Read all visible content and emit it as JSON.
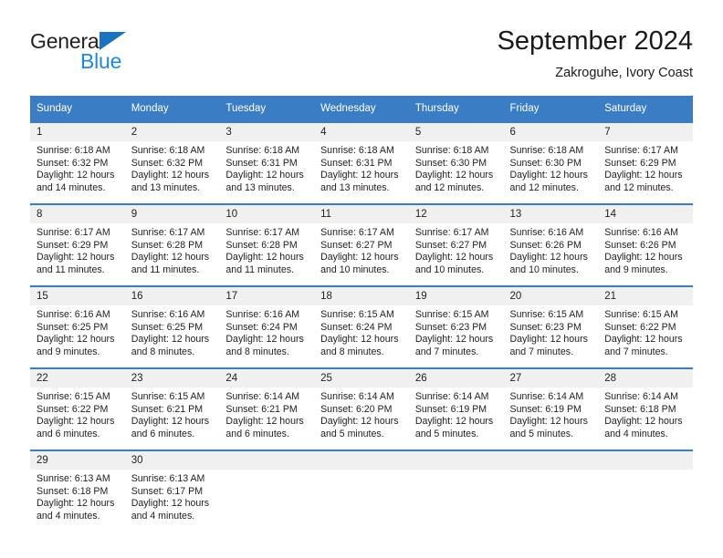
{
  "brand": {
    "name_part1": "General",
    "name_part2": "Blue",
    "triangle_icon": "brand-triangle-icon",
    "color_dark": "#231f20",
    "color_blue": "#2387d8"
  },
  "header": {
    "title": "September 2024",
    "subtitle": "Zakroguhe, Ivory Coast"
  },
  "theme": {
    "header_bg": "#3a7dc4",
    "daynum_bg": "#f0f0f0",
    "text": "#222222"
  },
  "weekday_headers": [
    "Sunday",
    "Monday",
    "Tuesday",
    "Wednesday",
    "Thursday",
    "Friday",
    "Saturday"
  ],
  "weeks": [
    {
      "days": [
        {
          "date": "1",
          "sunrise": "Sunrise: 6:18 AM",
          "sunset": "Sunset: 6:32 PM",
          "daylight_line1": "Daylight: 12 hours",
          "daylight_line2": "and 14 minutes."
        },
        {
          "date": "2",
          "sunrise": "Sunrise: 6:18 AM",
          "sunset": "Sunset: 6:32 PM",
          "daylight_line1": "Daylight: 12 hours",
          "daylight_line2": "and 13 minutes."
        },
        {
          "date": "3",
          "sunrise": "Sunrise: 6:18 AM",
          "sunset": "Sunset: 6:31 PM",
          "daylight_line1": "Daylight: 12 hours",
          "daylight_line2": "and 13 minutes."
        },
        {
          "date": "4",
          "sunrise": "Sunrise: 6:18 AM",
          "sunset": "Sunset: 6:31 PM",
          "daylight_line1": "Daylight: 12 hours",
          "daylight_line2": "and 13 minutes."
        },
        {
          "date": "5",
          "sunrise": "Sunrise: 6:18 AM",
          "sunset": "Sunset: 6:30 PM",
          "daylight_line1": "Daylight: 12 hours",
          "daylight_line2": "and 12 minutes."
        },
        {
          "date": "6",
          "sunrise": "Sunrise: 6:18 AM",
          "sunset": "Sunset: 6:30 PM",
          "daylight_line1": "Daylight: 12 hours",
          "daylight_line2": "and 12 minutes."
        },
        {
          "date": "7",
          "sunrise": "Sunrise: 6:17 AM",
          "sunset": "Sunset: 6:29 PM",
          "daylight_line1": "Daylight: 12 hours",
          "daylight_line2": "and 12 minutes."
        }
      ]
    },
    {
      "days": [
        {
          "date": "8",
          "sunrise": "Sunrise: 6:17 AM",
          "sunset": "Sunset: 6:29 PM",
          "daylight_line1": "Daylight: 12 hours",
          "daylight_line2": "and 11 minutes."
        },
        {
          "date": "9",
          "sunrise": "Sunrise: 6:17 AM",
          "sunset": "Sunset: 6:28 PM",
          "daylight_line1": "Daylight: 12 hours",
          "daylight_line2": "and 11 minutes."
        },
        {
          "date": "10",
          "sunrise": "Sunrise: 6:17 AM",
          "sunset": "Sunset: 6:28 PM",
          "daylight_line1": "Daylight: 12 hours",
          "daylight_line2": "and 11 minutes."
        },
        {
          "date": "11",
          "sunrise": "Sunrise: 6:17 AM",
          "sunset": "Sunset: 6:27 PM",
          "daylight_line1": "Daylight: 12 hours",
          "daylight_line2": "and 10 minutes."
        },
        {
          "date": "12",
          "sunrise": "Sunrise: 6:17 AM",
          "sunset": "Sunset: 6:27 PM",
          "daylight_line1": "Daylight: 12 hours",
          "daylight_line2": "and 10 minutes."
        },
        {
          "date": "13",
          "sunrise": "Sunrise: 6:16 AM",
          "sunset": "Sunset: 6:26 PM",
          "daylight_line1": "Daylight: 12 hours",
          "daylight_line2": "and 10 minutes."
        },
        {
          "date": "14",
          "sunrise": "Sunrise: 6:16 AM",
          "sunset": "Sunset: 6:26 PM",
          "daylight_line1": "Daylight: 12 hours",
          "daylight_line2": "and 9 minutes."
        }
      ]
    },
    {
      "days": [
        {
          "date": "15",
          "sunrise": "Sunrise: 6:16 AM",
          "sunset": "Sunset: 6:25 PM",
          "daylight_line1": "Daylight: 12 hours",
          "daylight_line2": "and 9 minutes."
        },
        {
          "date": "16",
          "sunrise": "Sunrise: 6:16 AM",
          "sunset": "Sunset: 6:25 PM",
          "daylight_line1": "Daylight: 12 hours",
          "daylight_line2": "and 8 minutes."
        },
        {
          "date": "17",
          "sunrise": "Sunrise: 6:16 AM",
          "sunset": "Sunset: 6:24 PM",
          "daylight_line1": "Daylight: 12 hours",
          "daylight_line2": "and 8 minutes."
        },
        {
          "date": "18",
          "sunrise": "Sunrise: 6:15 AM",
          "sunset": "Sunset: 6:24 PM",
          "daylight_line1": "Daylight: 12 hours",
          "daylight_line2": "and 8 minutes."
        },
        {
          "date": "19",
          "sunrise": "Sunrise: 6:15 AM",
          "sunset": "Sunset: 6:23 PM",
          "daylight_line1": "Daylight: 12 hours",
          "daylight_line2": "and 7 minutes."
        },
        {
          "date": "20",
          "sunrise": "Sunrise: 6:15 AM",
          "sunset": "Sunset: 6:23 PM",
          "daylight_line1": "Daylight: 12 hours",
          "daylight_line2": "and 7 minutes."
        },
        {
          "date": "21",
          "sunrise": "Sunrise: 6:15 AM",
          "sunset": "Sunset: 6:22 PM",
          "daylight_line1": "Daylight: 12 hours",
          "daylight_line2": "and 7 minutes."
        }
      ]
    },
    {
      "days": [
        {
          "date": "22",
          "sunrise": "Sunrise: 6:15 AM",
          "sunset": "Sunset: 6:22 PM",
          "daylight_line1": "Daylight: 12 hours",
          "daylight_line2": "and 6 minutes."
        },
        {
          "date": "23",
          "sunrise": "Sunrise: 6:15 AM",
          "sunset": "Sunset: 6:21 PM",
          "daylight_line1": "Daylight: 12 hours",
          "daylight_line2": "and 6 minutes."
        },
        {
          "date": "24",
          "sunrise": "Sunrise: 6:14 AM",
          "sunset": "Sunset: 6:21 PM",
          "daylight_line1": "Daylight: 12 hours",
          "daylight_line2": "and 6 minutes."
        },
        {
          "date": "25",
          "sunrise": "Sunrise: 6:14 AM",
          "sunset": "Sunset: 6:20 PM",
          "daylight_line1": "Daylight: 12 hours",
          "daylight_line2": "and 5 minutes."
        },
        {
          "date": "26",
          "sunrise": "Sunrise: 6:14 AM",
          "sunset": "Sunset: 6:19 PM",
          "daylight_line1": "Daylight: 12 hours",
          "daylight_line2": "and 5 minutes."
        },
        {
          "date": "27",
          "sunrise": "Sunrise: 6:14 AM",
          "sunset": "Sunset: 6:19 PM",
          "daylight_line1": "Daylight: 12 hours",
          "daylight_line2": "and 5 minutes."
        },
        {
          "date": "28",
          "sunrise": "Sunrise: 6:14 AM",
          "sunset": "Sunset: 6:18 PM",
          "daylight_line1": "Daylight: 12 hours",
          "daylight_line2": "and 4 minutes."
        }
      ]
    },
    {
      "days": [
        {
          "date": "29",
          "sunrise": "Sunrise: 6:13 AM",
          "sunset": "Sunset: 6:18 PM",
          "daylight_line1": "Daylight: 12 hours",
          "daylight_line2": "and 4 minutes."
        },
        {
          "date": "30",
          "sunrise": "Sunrise: 6:13 AM",
          "sunset": "Sunset: 6:17 PM",
          "daylight_line1": "Daylight: 12 hours",
          "daylight_line2": "and 4 minutes."
        },
        {
          "date": "",
          "sunrise": "",
          "sunset": "",
          "daylight_line1": "",
          "daylight_line2": ""
        },
        {
          "date": "",
          "sunrise": "",
          "sunset": "",
          "daylight_line1": "",
          "daylight_line2": ""
        },
        {
          "date": "",
          "sunrise": "",
          "sunset": "",
          "daylight_line1": "",
          "daylight_line2": ""
        },
        {
          "date": "",
          "sunrise": "",
          "sunset": "",
          "daylight_line1": "",
          "daylight_line2": ""
        },
        {
          "date": "",
          "sunrise": "",
          "sunset": "",
          "daylight_line1": "",
          "daylight_line2": ""
        }
      ]
    }
  ]
}
